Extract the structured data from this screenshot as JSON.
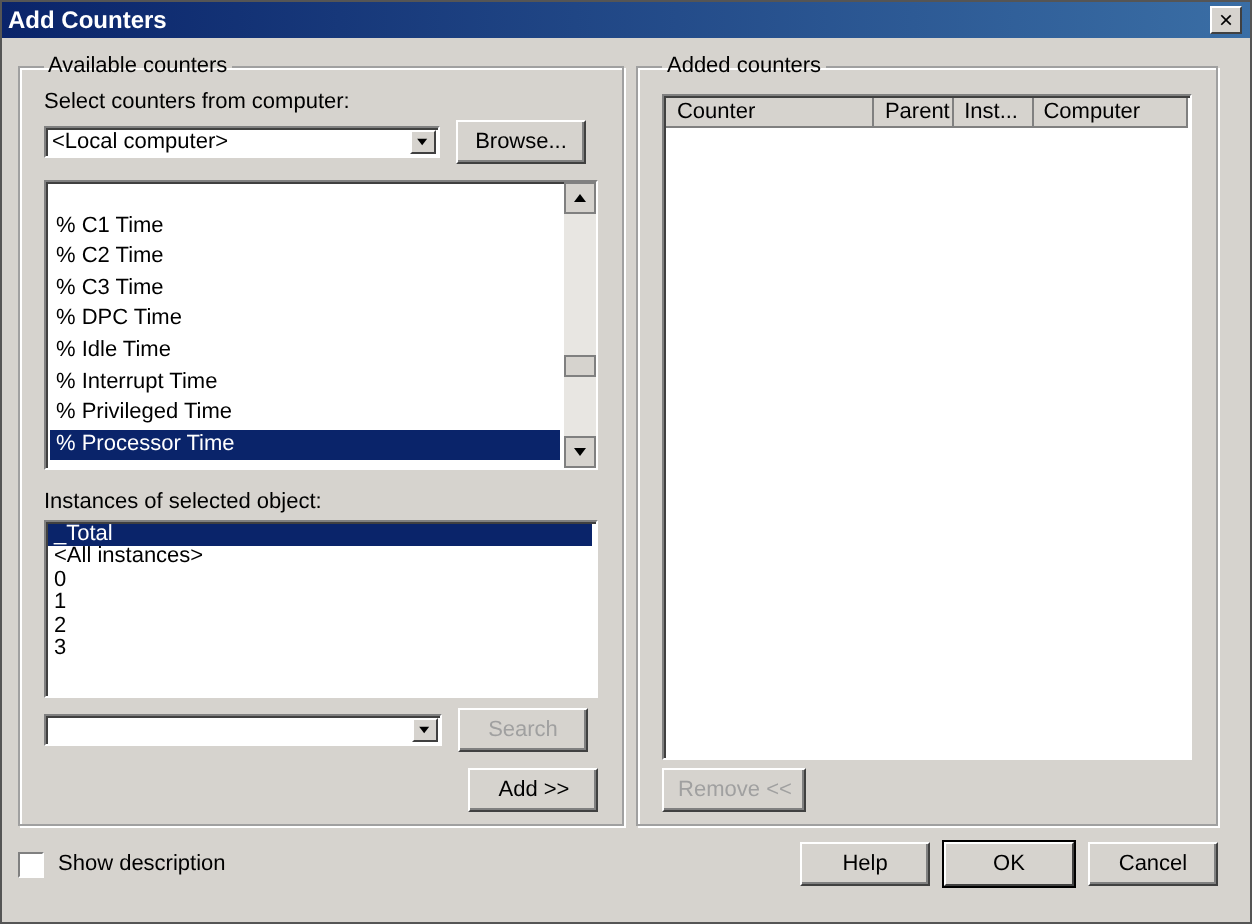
{
  "window": {
    "title": "Add Counters",
    "close": "×"
  },
  "available": {
    "title": "Available counters",
    "computer_label": "Select counters from computer:",
    "computer_value": "<Local computer>",
    "browse": "Browse...",
    "counters": [
      {
        "label": "% C1 Time",
        "selected": false
      },
      {
        "label": "% C2 Time",
        "selected": false
      },
      {
        "label": "% C3 Time",
        "selected": false
      },
      {
        "label": "% DPC Time",
        "selected": false
      },
      {
        "label": "% Idle Time",
        "selected": false
      },
      {
        "label": "% Interrupt Time",
        "selected": false
      },
      {
        "label": "% Privileged Time",
        "selected": false
      },
      {
        "label": "% Processor Time",
        "selected": true
      }
    ],
    "instances_label": "Instances of selected object:",
    "instances": [
      {
        "label": "_Total",
        "selected": true
      },
      {
        "label": "<All instances>",
        "selected": false
      },
      {
        "label": "0",
        "selected": false
      },
      {
        "label": "1",
        "selected": false
      },
      {
        "label": "2",
        "selected": false
      },
      {
        "label": "3",
        "selected": false
      }
    ],
    "search": {
      "label": "Search",
      "disabled": true
    },
    "add": {
      "label": "Add >>",
      "disabled": false
    }
  },
  "added": {
    "title": "Added counters",
    "columns": [
      "Counter",
      "Parent",
      "Inst...",
      "Computer"
    ],
    "remove": {
      "label": "Remove <<",
      "disabled": true
    }
  },
  "show_description": {
    "label": "Show description",
    "checked": false
  },
  "buttons": [
    {
      "label": "Help",
      "default": false
    },
    {
      "label": "OK",
      "default": true
    },
    {
      "label": "Cancel",
      "default": false
    }
  ]
}
